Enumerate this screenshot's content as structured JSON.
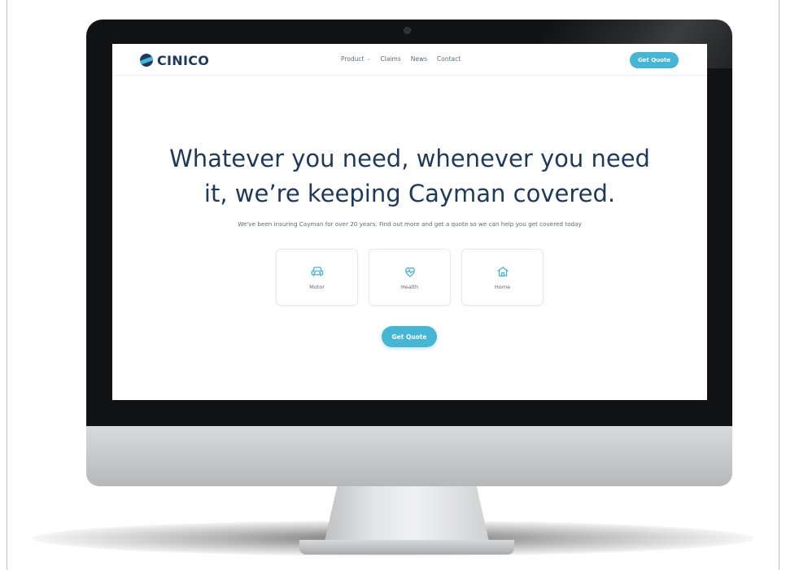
{
  "nav": {
    "logo_text": "CINICO",
    "links": [
      {
        "label": "Product",
        "has_dropdown": true
      },
      {
        "label": "Claims"
      },
      {
        "label": "News"
      },
      {
        "label": "Contact"
      }
    ],
    "cta_label": "Get Quote"
  },
  "hero": {
    "title_line1": "Whatever you need, whenever you need",
    "title_line2": "it, we’re keeping Cayman covered.",
    "subtitle": "We've been insuring Cayman for over 20 years. Find out more and get a quote so we can help you get covered today",
    "cards": [
      {
        "label": "Motor",
        "icon": "car-icon"
      },
      {
        "label": "Health",
        "icon": "heart-pulse-icon"
      },
      {
        "label": "Home",
        "icon": "house-icon"
      }
    ],
    "cta_label": "Get Quote"
  },
  "colors": {
    "brand_navy": "#1d3a5c",
    "accent": "#46b6d6",
    "body_text": "#5b6b7d"
  }
}
